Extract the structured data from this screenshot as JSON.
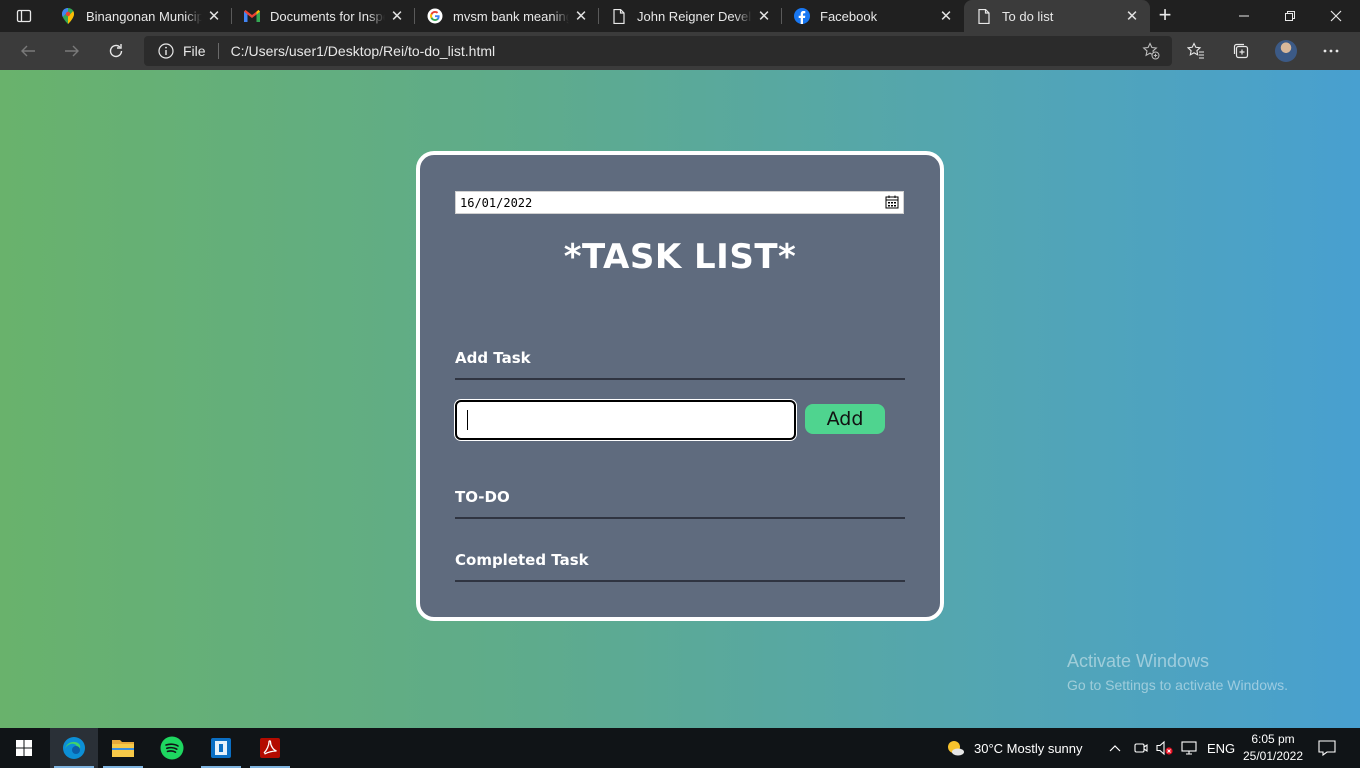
{
  "browser": {
    "tabs": [
      {
        "title": "Binangonan Municipal",
        "icon": "google-maps-icon"
      },
      {
        "title": "Documents for Inspection",
        "icon": "gmail-icon"
      },
      {
        "title": "mvsm bank meaning - Google Search",
        "icon": "google-icon"
      },
      {
        "title": "John Reigner Devela Portfolio",
        "icon": "document-icon"
      },
      {
        "title": "Facebook",
        "icon": "facebook-icon"
      },
      {
        "title": "To do list",
        "icon": "document-icon",
        "active": true
      }
    ],
    "address": {
      "scheme": "File",
      "url": "C:/Users/user1/Desktop/Rei/to-do_list.html"
    }
  },
  "app": {
    "date_value": "16/01/2022",
    "title": "*TASK LIST*",
    "add_task_heading": "Add Task",
    "task_input_value": "",
    "add_button_label": "Add",
    "todo_heading": "TO-DO",
    "completed_heading": "Completed Task"
  },
  "watermark": {
    "line1": "Activate Windows",
    "line2": "Go to Settings to activate Windows."
  },
  "taskbar": {
    "weather": "30°C  Mostly sunny",
    "language": "ENG",
    "time": "6:05 pm",
    "date": "25/01/2022"
  },
  "colors": {
    "card_bg": "#5f6b7e",
    "add_button": "#4fd48f",
    "gradient_left": "#69b26c",
    "gradient_right": "#48a0d0"
  }
}
